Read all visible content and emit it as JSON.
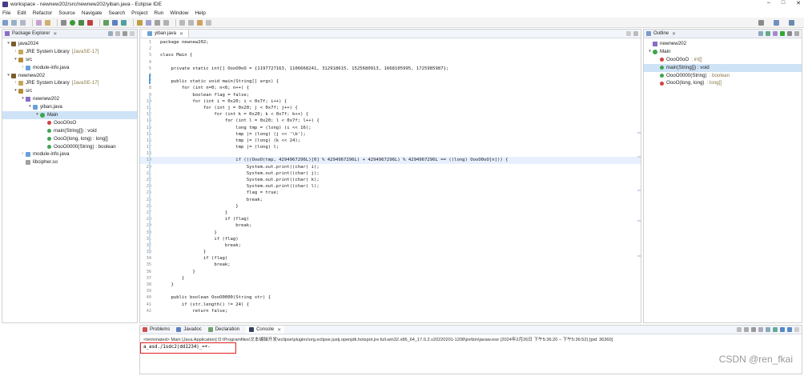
{
  "window": {
    "title": "workspace - newnew202/src/newnew202/yiban.java - Eclipse IDE",
    "controls": [
      "–",
      "□",
      "✕"
    ]
  },
  "menu": [
    "File",
    "Edit",
    "Refactor",
    "Source",
    "Navigate",
    "Search",
    "Project",
    "Run",
    "Window",
    "Help"
  ],
  "package_explorer": {
    "title": "Package Explorer",
    "close": "✕",
    "nodes": [
      {
        "label": "java2024",
        "extra": "",
        "indent": 0,
        "arrow": "▾",
        "icon": "proj"
      },
      {
        "label": "JRE System Library",
        "extra": "[JavaSE-17]",
        "indent": 1,
        "arrow": "›",
        "icon": "lib"
      },
      {
        "label": "src",
        "extra": "",
        "indent": 1,
        "arrow": "▾",
        "icon": "pkgf"
      },
      {
        "label": "module-info.java",
        "extra": "",
        "indent": 2,
        "arrow": "›",
        "icon": "java"
      },
      {
        "label": "newnew202",
        "extra": "",
        "indent": 0,
        "arrow": "▾",
        "icon": "proj"
      },
      {
        "label": "JRE System Library",
        "extra": "[JavaSE-17]",
        "indent": 1,
        "arrow": "›",
        "icon": "lib"
      },
      {
        "label": "src",
        "extra": "",
        "indent": 1,
        "arrow": "▾",
        "icon": "pkgf"
      },
      {
        "label": "newnew202",
        "extra": "",
        "indent": 2,
        "arrow": "▾",
        "icon": "pkg"
      },
      {
        "label": "yiban.java",
        "extra": "",
        "indent": 3,
        "arrow": "▾",
        "icon": "java"
      },
      {
        "label": "Main",
        "extra": "",
        "indent": 4,
        "arrow": "▾",
        "icon": "cls",
        "selected": true
      },
      {
        "label": "OooO0oO",
        "extra": "",
        "indent": 5,
        "arrow": "",
        "icon": "fld"
      },
      {
        "label": "main(String[]) : void",
        "extra": "",
        "indent": 5,
        "arrow": "",
        "icon": "mth"
      },
      {
        "label": "OooO(long, long) : long[]",
        "extra": "",
        "indent": 5,
        "arrow": "",
        "icon": "mth"
      },
      {
        "label": "OooO0000(String) : boolean",
        "extra": "",
        "indent": 5,
        "arrow": "",
        "icon": "mth"
      },
      {
        "label": "module-info.java",
        "extra": "",
        "indent": 2,
        "arrow": "›",
        "icon": "java"
      },
      {
        "label": "libcipher.so",
        "extra": "",
        "indent": 2,
        "arrow": "",
        "icon": "so"
      }
    ]
  },
  "editor": {
    "tab": "yiban.java",
    "close": "✕",
    "lines": [
      {
        "n": "1",
        "t": "package newnew202;"
      },
      {
        "n": "2",
        "t": ""
      },
      {
        "n": "3",
        "t": "class Main {"
      },
      {
        "n": "4",
        "t": ""
      },
      {
        "n": "5",
        "t": "    private static int[] OooO0oO = {1197727163, 1106668241, 312918615, 1525680913, 1668105995, 1725985987};"
      },
      {
        "n": "6",
        "t": ""
      },
      {
        "n": "7",
        "t": "    public static void main(String[] args) {"
      },
      {
        "n": "8",
        "t": "        for (int n=0; n<6; n++) {"
      },
      {
        "n": "9",
        "t": "            boolean flag = false;"
      },
      {
        "n": "10",
        "t": "            for (int i = 0x20; i < 0x7f; i++) {"
      },
      {
        "n": "11",
        "t": "                for (int j = 0x20; j < 0x7f; j++) {"
      },
      {
        "n": "12",
        "t": "                    for (int k = 0x20; k < 0x7f; k++) {"
      },
      {
        "n": "13",
        "t": "                        for (int l = 0x20; l < 0x7f; l++) {"
      },
      {
        "n": "14",
        "t": "                            long tmp = (long) (i << 16);"
      },
      {
        "n": "15",
        "t": "                            tmp |= (long) (j << '\\b');"
      },
      {
        "n": "16",
        "t": "                            tmp |= (long) (k << 24);"
      },
      {
        "n": "17",
        "t": "                            tmp |= (long) l;"
      },
      {
        "n": "18",
        "t": ""
      },
      {
        "n": "19",
        "t": "                            if (((OooO(tmp, 4294967296L)[0] % 4294967296L) + 4294967296L) % 4294967296L == ((long) OooO0oO[n])) {",
        "hl": true
      },
      {
        "n": "20",
        "t": "                                System.out.print((char) i);"
      },
      {
        "n": "21",
        "t": "                                System.out.print((char) j);"
      },
      {
        "n": "22",
        "t": "                                System.out.print((char) k);"
      },
      {
        "n": "23",
        "t": "                                System.out.print((char) l);"
      },
      {
        "n": "24",
        "t": "                                flag = true;"
      },
      {
        "n": "25",
        "t": "                                break;"
      },
      {
        "n": "26",
        "t": "                            }"
      },
      {
        "n": "27",
        "t": "                        }"
      },
      {
        "n": "28",
        "t": "                        if (flag)"
      },
      {
        "n": "29",
        "t": "                            break;"
      },
      {
        "n": "30",
        "t": "                    }"
      },
      {
        "n": "31",
        "t": "                    if (flag)"
      },
      {
        "n": "32",
        "t": "                        break;"
      },
      {
        "n": "33",
        "t": "                }"
      },
      {
        "n": "34",
        "t": "                if (flag)"
      },
      {
        "n": "35",
        "t": "                    break;"
      },
      {
        "n": "36",
        "t": "            }"
      },
      {
        "n": "37",
        "t": "        }"
      },
      {
        "n": "38",
        "t": "    }"
      },
      {
        "n": "39",
        "t": ""
      },
      {
        "n": "40",
        "t": "    public boolean OooO0000(String str) {"
      },
      {
        "n": "41",
        "t": "        if (str.length() != 24) {"
      },
      {
        "n": "42",
        "t": "            return false;"
      }
    ]
  },
  "outline": {
    "title": "Outline",
    "close": "✕",
    "nodes": [
      {
        "label": "newnew202",
        "indent": 0,
        "icon": "pkg",
        "arrow": ""
      },
      {
        "label": "Main",
        "indent": 0,
        "icon": "cls",
        "arrow": "▾"
      },
      {
        "label": "OooO0oO",
        "extra": ": int[]",
        "indent": 1,
        "icon": "fld",
        "arrow": ""
      },
      {
        "label": "main(String[]) : void",
        "extra": "",
        "indent": 1,
        "icon": "mth",
        "arrow": "",
        "selected": true
      },
      {
        "label": "OooO0000(String)",
        "extra": ": boolean",
        "indent": 1,
        "icon": "mth",
        "arrow": ""
      },
      {
        "label": "OooO(long, long)",
        "extra": ": long[]",
        "indent": 1,
        "icon": "fld",
        "arrow": ""
      }
    ]
  },
  "bottom": {
    "tabs": [
      "Problems",
      "Javadoc",
      "Declaration",
      "Console"
    ],
    "active_tab": "Console",
    "terminated": "<terminated> Main [Java Application] D:\\Programfiles\\文本编辑开发\\eclipse\\plugins\\org.eclipse.justj.openjdk.hotspot.jre.full.win32.x86_64_17.0.2.v20220201-1208\\jre\\bin\\javaw.exe  (2024年2月26日 下午5:36:20 – 下午5:36:52) [pid: 36360]",
    "output": "a_asd./1sdc2)dd1234)_=+-"
  },
  "watermark": "CSDN @ren_fkai"
}
